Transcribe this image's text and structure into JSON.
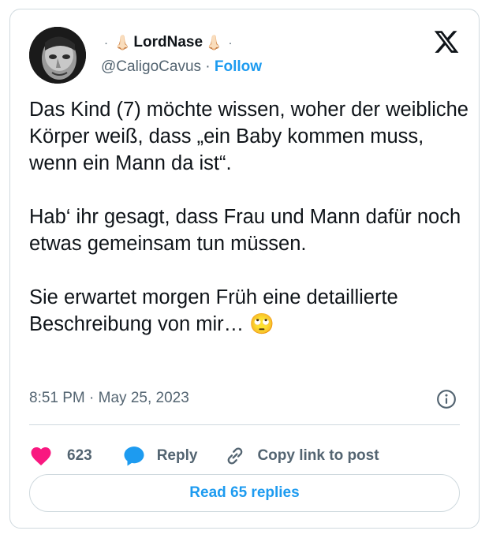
{
  "author": {
    "display_name": "LordNase",
    "name_prefix_glyph": "·",
    "name_suffix_glyph": "·",
    "nose_emoji": "👃🏻",
    "handle": "@CaligoCavus",
    "separator": " · ",
    "follow_label": "Follow"
  },
  "tweet": {
    "paragraphs": [
      "Das Kind (7) möchte wissen, woher der weibliche Körper weiß, dass „ein Baby kommen muss, wenn ein Mann da ist“.",
      "Hab‘ ihr gesagt, dass Frau und Mann dafür noch etwas gemeinsam tun müssen.",
      "Sie erwartet morgen Früh eine detaillierte Beschreibung von mir…"
    ],
    "trailing_emoji": "🙄",
    "timestamp": "8:51 PM · May 25, 2023"
  },
  "actions": {
    "like_count": "623",
    "reply_label": "Reply",
    "copy_link_label": "Copy link to post",
    "read_replies_label": "Read 65 replies"
  },
  "colors": {
    "like": "#f91880",
    "accent": "#1d9bf0",
    "text": "#0f1419",
    "muted": "#536471",
    "border": "#cfd9de"
  },
  "icons": [
    "x-logo-icon",
    "info-icon",
    "heart-icon",
    "reply-bubble-icon",
    "link-icon",
    "face-with-rolling-eyes-emoji"
  ]
}
